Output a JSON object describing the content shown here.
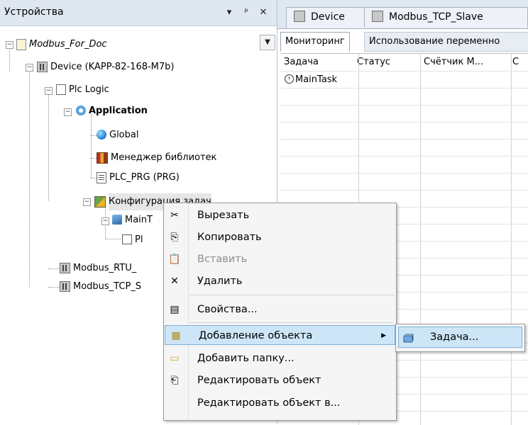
{
  "panel": {
    "title": "Устройства",
    "dropdown_glyph": "▾",
    "pin_glyph": "ᵖ",
    "close_glyph": "✕"
  },
  "tree": {
    "items": [
      {
        "label": "Modbus_For_Doc",
        "icon": "project-icon"
      },
      {
        "label": "Device (KAPP-82-168-M7b)",
        "icon": "device-icon"
      },
      {
        "label": "Plc Logic",
        "icon": "plc-logic-icon"
      },
      {
        "label": "Application",
        "icon": "application-icon"
      },
      {
        "label": "Global",
        "icon": "global-icon"
      },
      {
        "label": "Менеджер библиотек",
        "icon": "library-icon"
      },
      {
        "label": "PLC_PRG (PRG)",
        "icon": "program-icon"
      },
      {
        "label": "Конфигурация задач",
        "icon": "task-config-icon"
      },
      {
        "label": "MainT",
        "icon": "task-icon"
      },
      {
        "label": "Pl",
        "icon": "object-icon"
      },
      {
        "label": "Modbus_RTU_",
        "icon": "device-icon"
      },
      {
        "label": "Modbus_TCP_S",
        "icon": "device-icon"
      }
    ]
  },
  "editor": {
    "tabs": [
      {
        "label": "Device"
      },
      {
        "label": "Modbus_TCP_Slave"
      }
    ],
    "subtabs": [
      {
        "label": "Мониторинг"
      },
      {
        "label": "Использование переменно"
      }
    ],
    "columns": [
      "Задача",
      "Статус",
      "Счётчик М...",
      "С"
    ],
    "rows": [
      {
        "task": "MainTask"
      }
    ]
  },
  "context_menu": {
    "items": [
      {
        "label": "Вырезать",
        "icon": "scissors-icon",
        "glyph": "✂"
      },
      {
        "label": "Копировать",
        "icon": "copy-icon",
        "glyph": "⎘"
      },
      {
        "label": "Вставить",
        "icon": "paste-icon",
        "glyph": "📋"
      },
      {
        "label": "Удалить",
        "icon": "delete-icon",
        "glyph": "✕"
      },
      {
        "label": "Свойства...",
        "icon": "properties-icon",
        "glyph": "▤"
      },
      {
        "label": "Добавление объекта",
        "icon": "add-object-icon",
        "glyph": "▦"
      },
      {
        "label": "Добавить папку...",
        "icon": "folder-icon",
        "glyph": "▭"
      },
      {
        "label": "Редактировать объект",
        "icon": "edit-object-icon",
        "glyph": "⎗"
      },
      {
        "label": "Редактировать объект в...",
        "icon": "",
        "glyph": ""
      }
    ],
    "submenu_arrow": "▶"
  },
  "submenu": {
    "items": [
      {
        "label": "Задача...",
        "icon": "task-icon"
      }
    ]
  },
  "colors": {
    "header_bg": "#dfe7f1",
    "highlight_bg": "#cde6f7",
    "highlight_border": "#7bb1dc",
    "disabled_text": "#8e8e8e"
  }
}
